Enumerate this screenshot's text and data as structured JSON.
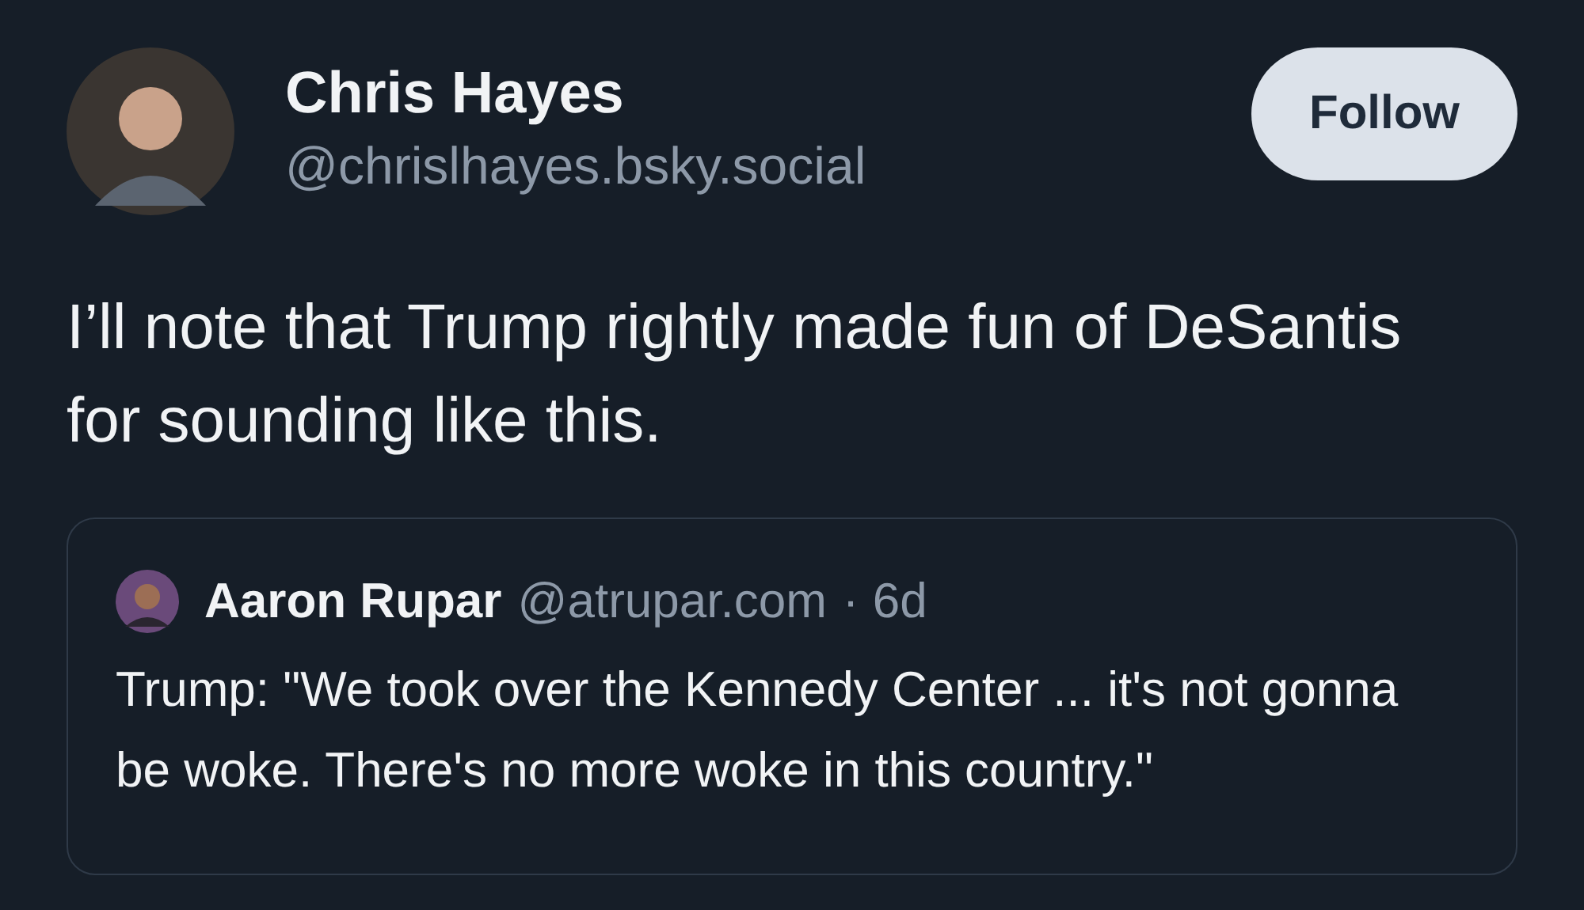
{
  "author": {
    "name": "Chris Hayes",
    "handle": "@chrislhayes.bsky.social"
  },
  "follow_button": {
    "label": "Follow"
  },
  "post_text": "I’ll note that Trump rightly made fun of DeSantis for sounding like this.",
  "quote": {
    "name": "Aaron Rupar",
    "handle": "@atrupar.com",
    "time": "· 6d",
    "text": "Trump: \"We took over the Kennedy Center ... it's not gonna be woke. There's no more woke in this country.\""
  }
}
